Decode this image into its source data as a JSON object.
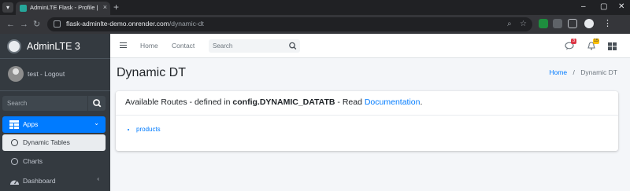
{
  "browser": {
    "tab_title": "AdminLTE Flask - Profile | App...",
    "tab_close": "×",
    "new_tab": "+",
    "url_host": "flask-adminlte-demo.onrender.com",
    "url_path": "/dynamic-dt",
    "window_controls": [
      "–",
      "▢",
      "✕"
    ]
  },
  "sidebar": {
    "brand": "AdminLTE 3",
    "user": "test - Logout",
    "search_placeholder": "Search",
    "items": [
      {
        "label": "Apps",
        "icon": "grid-icon",
        "active": true
      },
      {
        "label": "Dynamic Tables",
        "icon": "circle-icon",
        "selected": true
      },
      {
        "label": "Charts",
        "icon": "circle-icon"
      },
      {
        "label": "Dashboard",
        "icon": "dashboard-icon"
      }
    ]
  },
  "navbar": {
    "links": [
      "Home",
      "Contact"
    ],
    "search_placeholder": "Search",
    "messages_badge": "3",
    "notifications_badge": "15"
  },
  "content": {
    "title": "Dynamic DT",
    "breadcrumb": {
      "home": "Home",
      "separator": "/",
      "current": "Dynamic DT"
    },
    "card": {
      "title_prefix": "Available Routes - defined in ",
      "config_name": "config.DYNAMIC_DATATB",
      "title_middle": " - Read ",
      "doc_link": "Documentation",
      "title_suffix": "."
    },
    "routes": [
      "products"
    ]
  },
  "colors": {
    "primary": "#007bff",
    "sidebar_bg": "#343a40",
    "badge_danger": "#dc3545",
    "badge_warning": "#ffc107"
  }
}
